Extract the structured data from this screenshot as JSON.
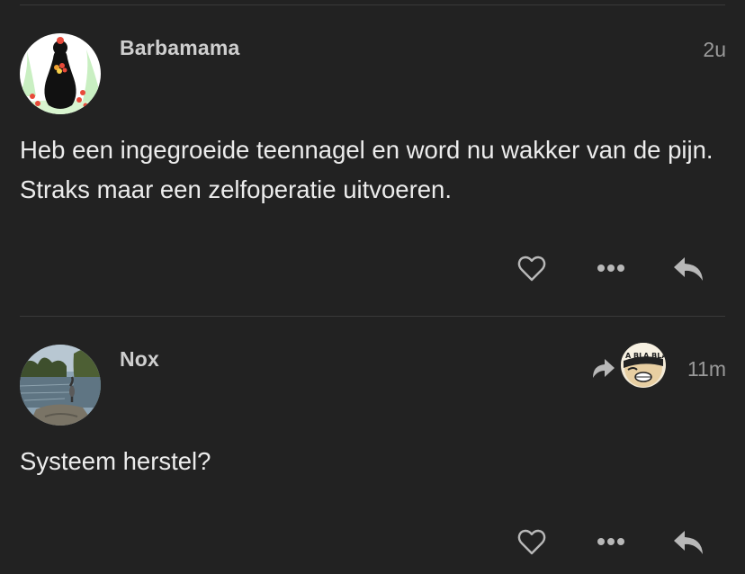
{
  "posts": [
    {
      "username": "Barbamama",
      "time": "2u",
      "content": "Heb een ingegroeide teennagel en word nu wakker van de pijn. Straks maar een zelfoperatie uitvoeren.",
      "avatar_icon": "barbamama-avatar"
    },
    {
      "username": "Nox",
      "time": "11m",
      "content": "Systeem herstel?",
      "avatar_icon": "heron-lake-avatar",
      "boosted_by": {
        "icon": "boost-icon",
        "avatar_text": "A BLA BLA"
      }
    }
  ],
  "actions": {
    "like_icon": "heart-icon",
    "more_icon": "more-icon",
    "reply_icon": "reply-icon"
  },
  "colors": {
    "background": "#222222",
    "text": "#ececec",
    "muted": "#9a9a9a",
    "icon": "#b8b8b8",
    "divider": "#3a3a3a"
  }
}
